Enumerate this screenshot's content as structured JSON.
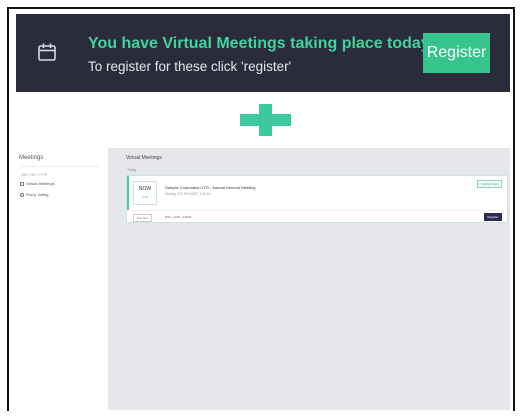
{
  "banner": {
    "title": "You have Virtual Meetings taking place today",
    "subtitle": "To register for these click 'register'",
    "register_label": "Register",
    "icon": "calendar-icon"
  },
  "plus_icon": "plus-icon",
  "app": {
    "sidebar": {
      "title": "Meetings",
      "section_label": "MEETING TYPE",
      "items": [
        {
          "label": "Virtual Meetings",
          "icon": "meeting-icon"
        },
        {
          "label": "Proxy Voting",
          "icon": "gear-icon"
        }
      ]
    },
    "main": {
      "title": "Virtual Meetings",
      "today_label": "Today",
      "meeting": {
        "date_main": "NOW",
        "date_sub": "LIVE",
        "name": "Sample Corporation LTD - Annual General Meeting",
        "time": "Starting 3:00 PM (GMT) 1:00:00",
        "status_badge": "Voting Open",
        "reference": "2nd Nov",
        "code": "MTG_AGM_LIVE01",
        "register_label": "Register"
      }
    }
  },
  "colors": {
    "banner_bg": "#2a2c3c",
    "accent_green": "#41d49a",
    "register_btn": "#35c48c",
    "app_register_btn": "#2d2b55"
  }
}
